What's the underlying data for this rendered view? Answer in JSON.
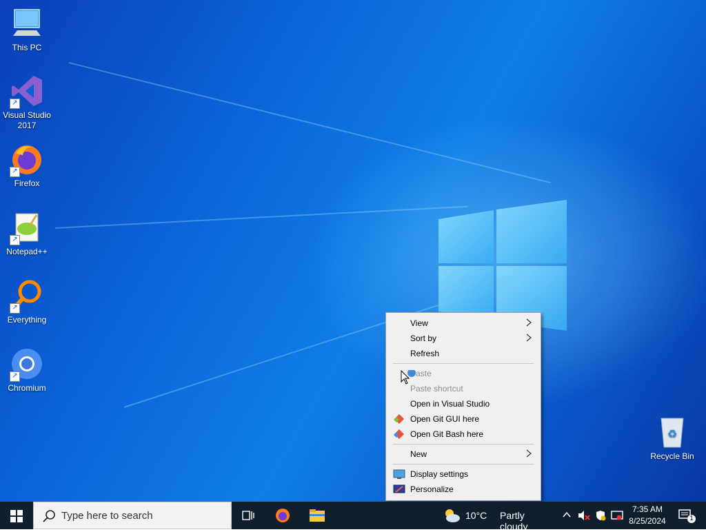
{
  "desktop": {
    "icons": [
      {
        "label": "This PC",
        "icon": "this-pc-icon"
      },
      {
        "label": "Visual Studio 2017",
        "icon": "visual-studio-icon"
      },
      {
        "label": "Firefox",
        "icon": "firefox-icon"
      },
      {
        "label": "Notepad++",
        "icon": "notepadpp-icon"
      },
      {
        "label": "Everything",
        "icon": "everything-icon"
      },
      {
        "label": "Chromium",
        "icon": "chromium-icon"
      },
      {
        "label": "Recycle Bin",
        "icon": "recycle-bin-icon"
      }
    ]
  },
  "context_menu": {
    "items": [
      {
        "label": "View",
        "submenu": true,
        "enabled": true
      },
      {
        "label": "Sort by",
        "submenu": true,
        "enabled": true
      },
      {
        "label": "Refresh",
        "enabled": true
      },
      {
        "label": "Paste",
        "enabled": false
      },
      {
        "label": "Paste shortcut",
        "enabled": false
      },
      {
        "label": "Open in Visual Studio",
        "enabled": true
      },
      {
        "label": "Open Git GUI here",
        "enabled": true,
        "icon": "git-gui-icon"
      },
      {
        "label": "Open Git Bash here",
        "enabled": true,
        "icon": "git-bash-icon"
      },
      {
        "label": "New",
        "submenu": true,
        "enabled": true
      },
      {
        "label": "Display settings",
        "enabled": true,
        "icon": "display-settings-icon"
      },
      {
        "label": "Personalize",
        "enabled": true,
        "icon": "personalize-icon"
      }
    ]
  },
  "taskbar": {
    "search_placeholder": "Type here to search",
    "weather_temp": "10°C",
    "weather_text": "Partly cloudy",
    "time": "7:35 AM",
    "date": "8/25/2024",
    "notification_count": "1"
  },
  "colors": {
    "desktop_blue": "#0b63d8",
    "taskbar": "#0f1f2e",
    "menu_bg": "#f0f0f0"
  }
}
